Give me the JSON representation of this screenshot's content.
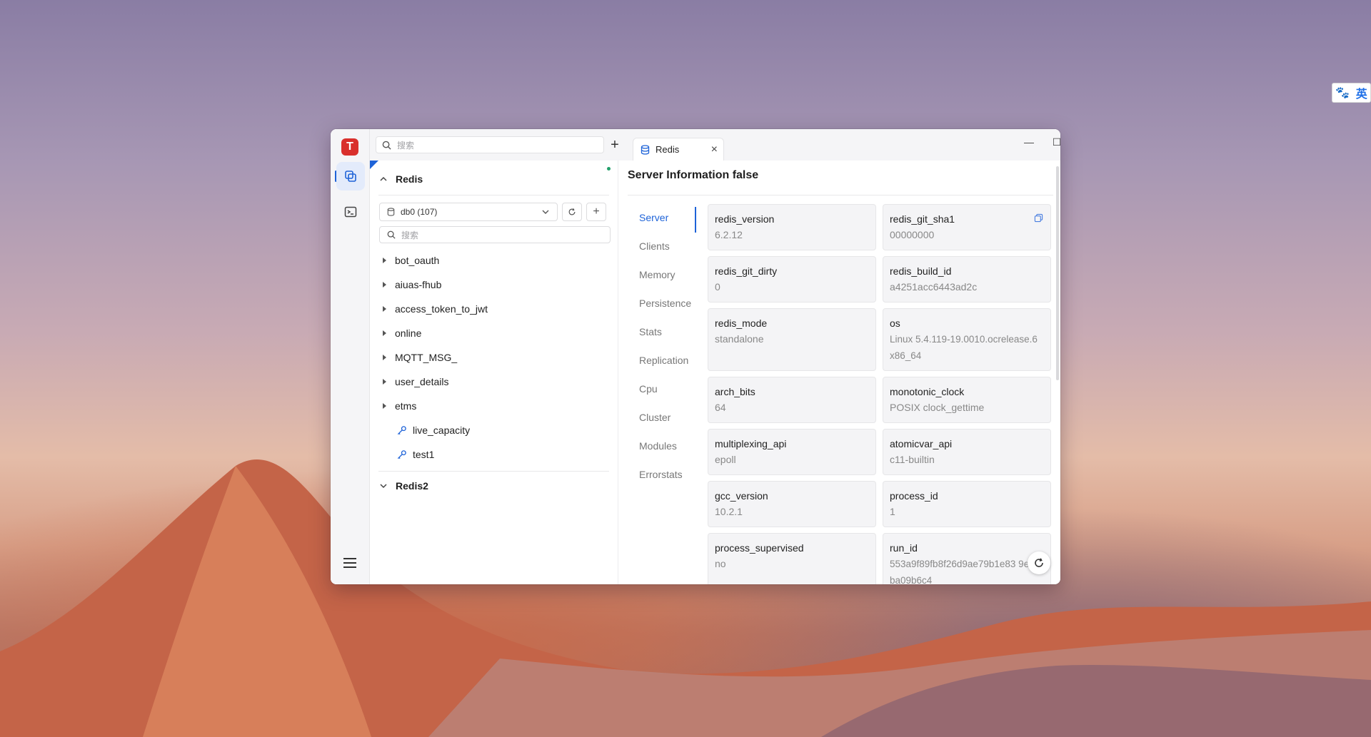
{
  "ime": {
    "paw": "🐾",
    "lang": "英"
  },
  "app": {
    "logo_letter": "T"
  },
  "topbar": {
    "search_placeholder": "搜索",
    "add_label": "+"
  },
  "tab": {
    "label": "Redis",
    "close": "×"
  },
  "window_controls": {
    "minimize": "—",
    "maximize": "☐",
    "close": "✕"
  },
  "tree": {
    "connection1": "Redis",
    "db_select": "db0 (107)",
    "key_search_placeholder": "搜索",
    "add_label": "+",
    "folders": [
      "bot_oauth",
      "aiuas-fhub",
      "access_token_to_jwt",
      "online",
      "MQTT_MSG_",
      "user_details",
      "etms"
    ],
    "keys": [
      "live_capacity",
      "test1"
    ],
    "connection2": "Redis2"
  },
  "detail": {
    "title": "Server Information false",
    "sections": [
      "Server",
      "Clients",
      "Memory",
      "Persistence",
      "Stats",
      "Replication",
      "Cpu",
      "Cluster",
      "Modules",
      "Errorstats"
    ],
    "active_section": "Server",
    "cards": [
      {
        "k": "redis_version",
        "v": "6.2.12"
      },
      {
        "k": "redis_git_sha1",
        "v": "00000000"
      },
      {
        "k": "redis_git_dirty",
        "v": "0"
      },
      {
        "k": "redis_build_id",
        "v": "a4251acc6443ad2c"
      },
      {
        "k": "redis_mode",
        "v": "standalone"
      },
      {
        "k": "os",
        "v": "Linux 5.4.119-19.0010.ocrelease.6 x86_64"
      },
      {
        "k": "arch_bits",
        "v": "64"
      },
      {
        "k": "monotonic_clock",
        "v": "POSIX clock_gettime"
      },
      {
        "k": "multiplexing_api",
        "v": "epoll"
      },
      {
        "k": "atomicvar_api",
        "v": "c11-builtin"
      },
      {
        "k": "gcc_version",
        "v": "10.2.1"
      },
      {
        "k": "process_id",
        "v": "1"
      },
      {
        "k": "process_supervised",
        "v": "no"
      },
      {
        "k": "run_id",
        "v": "553a9f89fb8f26d9ae79b1e83 9eddba09b6c4"
      }
    ]
  }
}
